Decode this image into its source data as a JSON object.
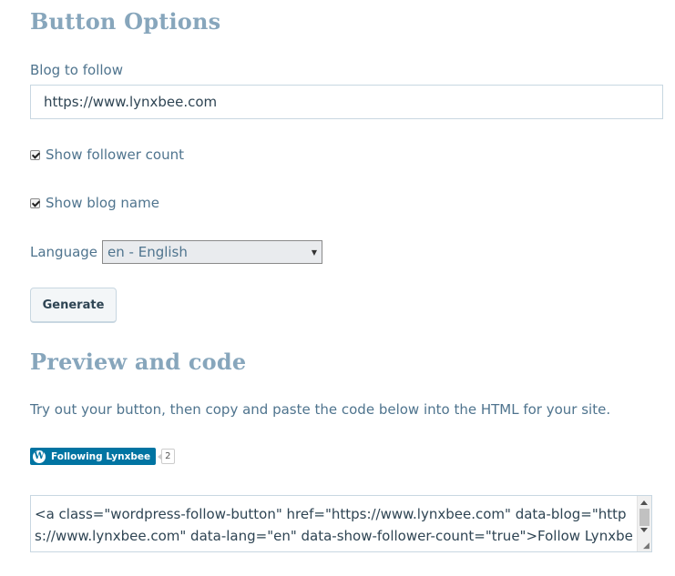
{
  "section1": {
    "heading": "Button Options"
  },
  "blog": {
    "label": "Blog to follow",
    "value": "https://www.lynxbee.com"
  },
  "options": {
    "show_follower_count_label": "Show follower count",
    "show_follower_count": true,
    "show_blog_name_label": "Show blog name",
    "show_blog_name": true
  },
  "language": {
    "label": "Language",
    "selected": "en - English"
  },
  "generate_label": "Generate",
  "section2": {
    "heading": "Preview and code",
    "description": "Try out your button, then copy and paste the code below into the HTML for your site."
  },
  "preview": {
    "button_label": "Following Lynxbee",
    "count": "2",
    "icon": "wordpress-icon"
  },
  "code": {
    "value": "<a class=\"wordpress-follow-button\" href=\"https://www.lynxbee.com\" data-blog=\"https://www.lynxbee.com\" data-lang=\"en\" data-show-follower-count=\"true\">Follow Lynxbee on WordPress.com</a>"
  }
}
